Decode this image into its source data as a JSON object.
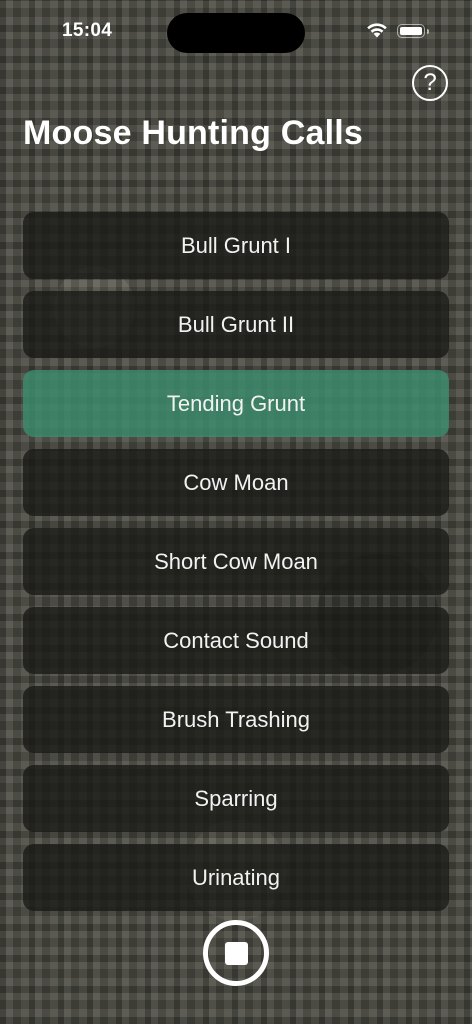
{
  "status_bar": {
    "time": "15:04"
  },
  "header": {
    "title": "Moose Hunting Calls",
    "help_label": "?"
  },
  "calls": [
    {
      "label": "Bull Grunt I",
      "active": false
    },
    {
      "label": "Bull Grunt II",
      "active": false
    },
    {
      "label": "Tending Grunt",
      "active": true
    },
    {
      "label": "Cow Moan",
      "active": false
    },
    {
      "label": "Short Cow Moan",
      "active": false
    },
    {
      "label": "Contact Sound",
      "active": false
    },
    {
      "label": "Brush Trashing",
      "active": false
    },
    {
      "label": "Sparring",
      "active": false
    },
    {
      "label": "Urinating",
      "active": false
    }
  ],
  "icons": {
    "help": "question-circle-icon",
    "stop": "stop-icon",
    "wifi": "wifi-icon",
    "battery": "battery-icon"
  },
  "colors": {
    "active_call": "#3a8c6c",
    "call_button": "#181816",
    "text": "#ffffff"
  }
}
